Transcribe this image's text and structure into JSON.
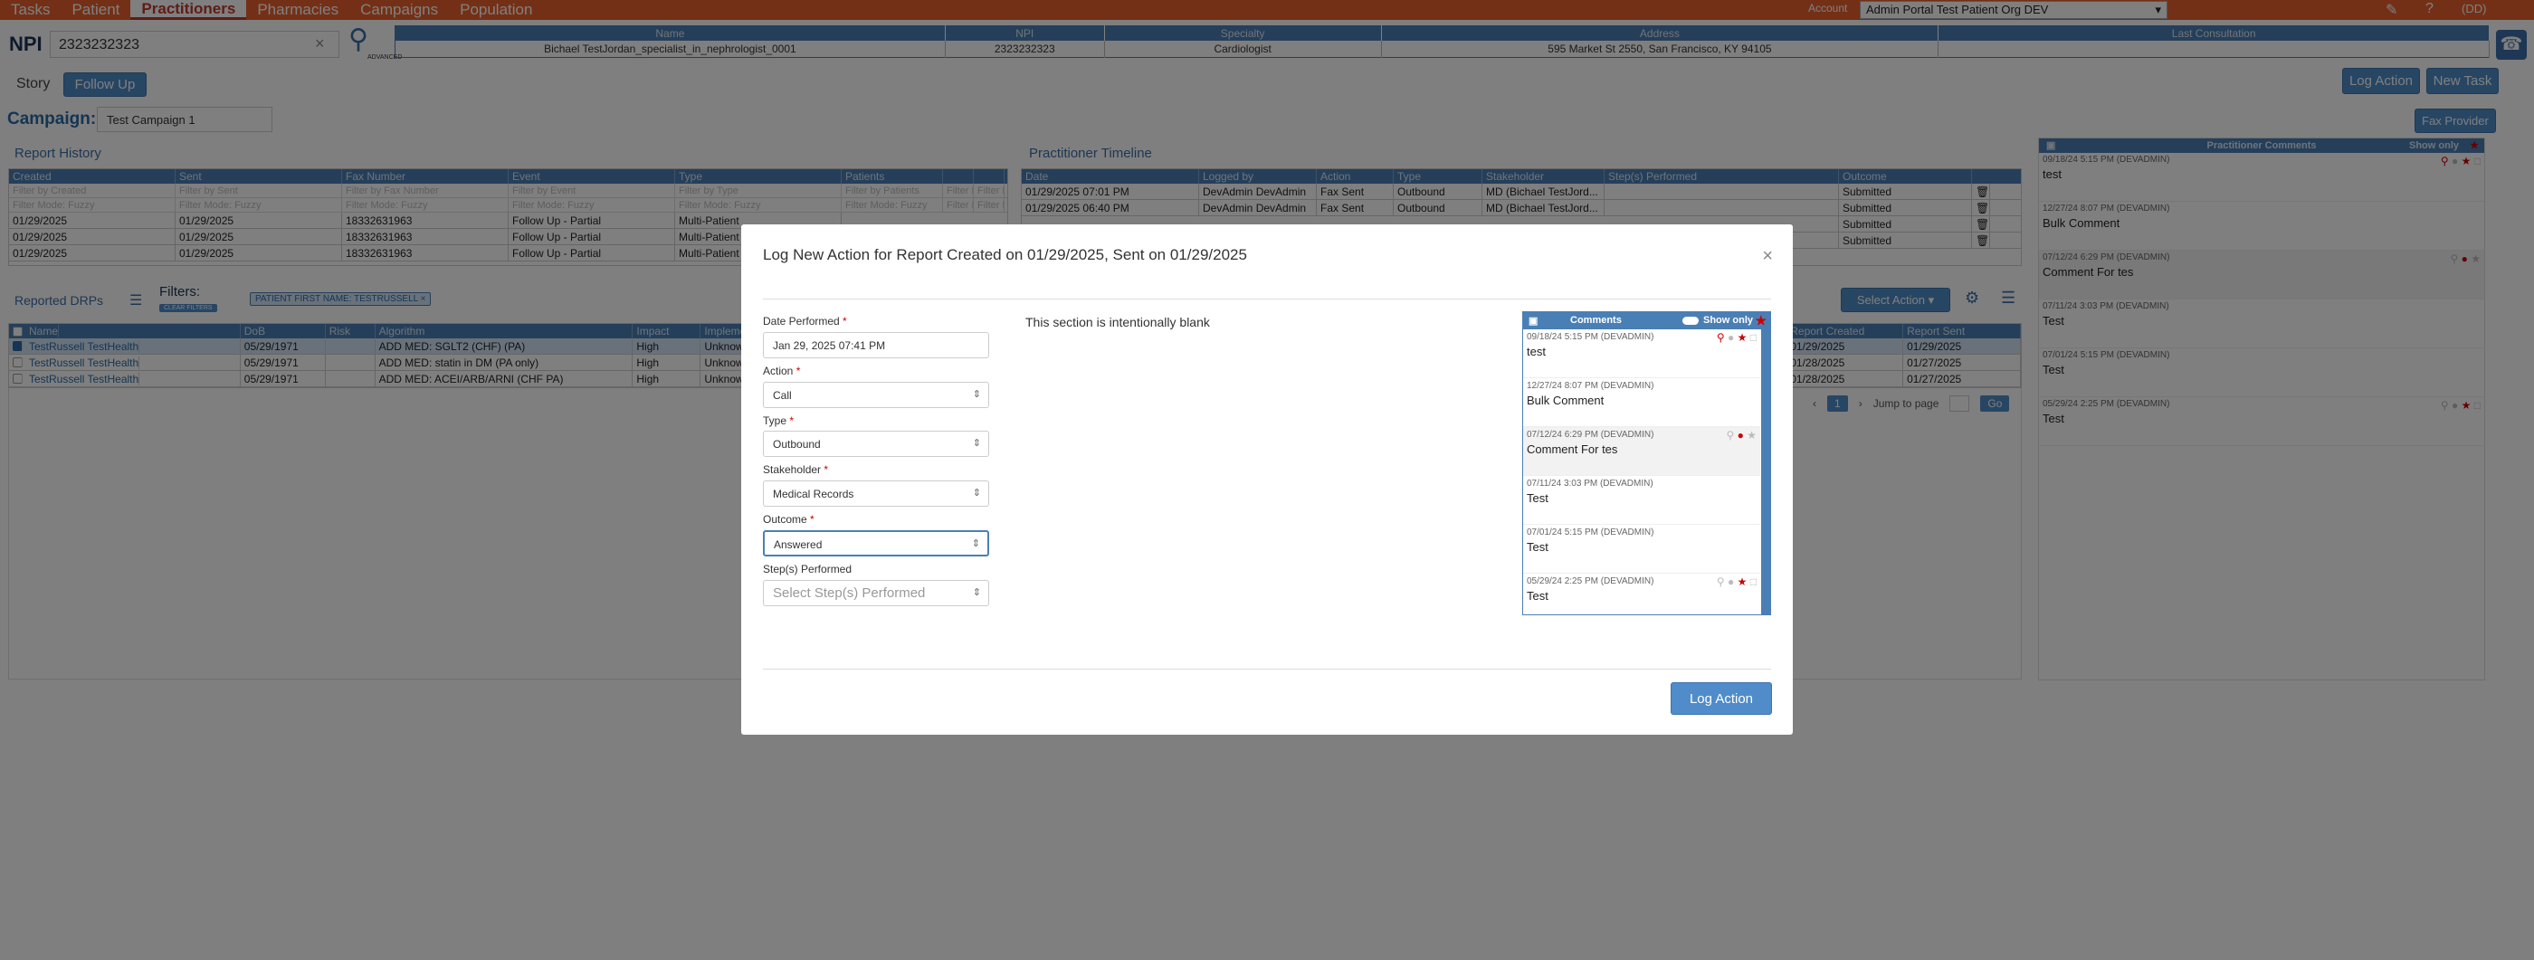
{
  "nav": {
    "tabs": [
      "Tasks",
      "Patient",
      "Practitioners",
      "Pharmacies",
      "Campaigns",
      "Population"
    ],
    "active": "Practitioners",
    "account_label": "Account",
    "account_value": "Admin Portal Test Patient Org DEV",
    "user": "(DD)"
  },
  "search": {
    "label": "NPI",
    "value": "2323232323",
    "advanced": "ADVANCED"
  },
  "header": {
    "columns": [
      "Name",
      "NPI",
      "Specialty",
      "Address",
      "Last Consultation"
    ],
    "values": [
      "Bichael TestJordan_specialist_in_nephrologist_0001",
      "2323232323",
      "Cardiologist",
      "595 Market St 2550, San Francisco, KY 94105",
      ""
    ]
  },
  "buttons": {
    "story": "Story",
    "follow_up": "Follow Up",
    "log_action": "Log Action",
    "new_task": "New Task",
    "fax_provider": "Fax Provider",
    "select_action": "Select Action",
    "go": "Go",
    "jump": "Jump to page",
    "page": "1"
  },
  "campaign": {
    "label": "Campaign:",
    "value": "Test Campaign 1"
  },
  "report_history": {
    "title": "Report History",
    "columns": [
      "Created",
      "Sent",
      "Fax Number",
      "Event",
      "Type",
      "Patients",
      "",
      ""
    ],
    "filters": [
      "Filter by Created",
      "Filter by Sent",
      "Filter by Fax Number",
      "Filter by Event",
      "Filter by Type",
      "Filter by Patients",
      "Filter D",
      "Filter P"
    ],
    "mode": "Filter Mode: Fuzzy",
    "rows": [
      [
        "01/29/2025",
        "01/29/2025",
        "18332631963",
        "Follow Up - Partial",
        "Multi-Patient"
      ],
      [
        "01/29/2025",
        "01/29/2025",
        "18332631963",
        "Follow Up - Partial",
        "Multi-Patient"
      ],
      [
        "01/29/2025",
        "01/29/2025",
        "18332631963",
        "Follow Up - Partial",
        "Multi-Patient"
      ]
    ]
  },
  "timeline": {
    "title": "Practitioner Timeline",
    "columns": [
      "Date",
      "Logged by",
      "Action",
      "Type",
      "Stakeholder",
      "Step(s) Performed",
      "Outcome"
    ],
    "filters": [],
    "rows": [
      [
        "01/29/2025 07:01 PM",
        "DevAdmin DevAdmin",
        "Fax Sent",
        "Outbound",
        "MD (Bichael TestJord...",
        "",
        "Submitted"
      ],
      [
        "01/29/2025 06:40 PM",
        "DevAdmin DevAdmin",
        "Fax Sent",
        "Outbound",
        "MD (Bichael TestJord...",
        "",
        "Submitted"
      ],
      [
        "",
        "",
        "",
        "",
        "",
        "",
        "Submitted"
      ],
      [
        "",
        "",
        "",
        "",
        "",
        "",
        "Submitted"
      ]
    ]
  },
  "drps": {
    "title": "Reported DRPs",
    "filters_label": "Filters:",
    "clear_filters": "CLEAR FILTERS",
    "chip": "PATIENT FIRST NAME: TESTRUSSELL",
    "columns": [
      "Name",
      "DoB",
      "Risk",
      "Algorithm",
      "Impact",
      "Impleme"
    ],
    "rows": [
      [
        "TestRussell TestHealth",
        "05/29/1971",
        "",
        "ADD MED: SGLT2 (CHF) (PA)",
        "High",
        "Unknown"
      ],
      [
        "TestRussell TestHealth",
        "05/29/1971",
        "",
        "ADD MED: statin in DM (PA only)",
        "High",
        "Unknown"
      ],
      [
        "TestRussell TestHealth",
        "05/29/1971",
        "",
        "ADD MED: ACEI/ARB/ARNI (CHF PA)",
        "High",
        "Unknown"
      ]
    ],
    "right_columns": [
      "Report Created",
      "Report Sent"
    ],
    "right_rows": [
      [
        "01/29/2025",
        "01/29/2025"
      ],
      [
        "01/28/2025",
        "01/27/2025"
      ],
      [
        "01/28/2025",
        "01/27/2025"
      ]
    ]
  },
  "practitioner_comments": {
    "title": "Practitioner Comments",
    "show_only": "Show only",
    "items": [
      {
        "meta": "09/18/24 5:15 PM (DEVADMIN)",
        "text": "test"
      },
      {
        "meta": "12/27/24 8:07 PM (DEVADMIN)",
        "text": "Bulk Comment"
      },
      {
        "meta": "07/12/24 6:29 PM (DEVADMIN)",
        "text": "Comment For tes"
      },
      {
        "meta": "07/11/24 3:03 PM (DEVADMIN)",
        "text": "Test"
      },
      {
        "meta": "07/01/24 5:15 PM (DEVADMIN)",
        "text": "Test"
      },
      {
        "meta": "05/29/24 2:25 PM (DEVADMIN)",
        "text": "Test"
      }
    ]
  },
  "modal": {
    "title": "Log New Action for Report Created on 01/29/2025, Sent on 01/29/2025",
    "date_label": "Date Performed",
    "date_value": "Jan 29, 2025 07:41 PM",
    "action_label": "Action",
    "action_value": "Call",
    "type_label": "Type",
    "type_value": "Outbound",
    "stakeholder_label": "Stakeholder",
    "stakeholder_value": "Medical Records",
    "outcome_label": "Outcome",
    "outcome_value": "Answered",
    "steps_label": "Step(s) Performed",
    "steps_placeholder": "Select Step(s) Performed",
    "blank": "This section is intentionally blank",
    "log_button": "Log Action",
    "comments_title": "Comments",
    "show_only": "Show only"
  }
}
